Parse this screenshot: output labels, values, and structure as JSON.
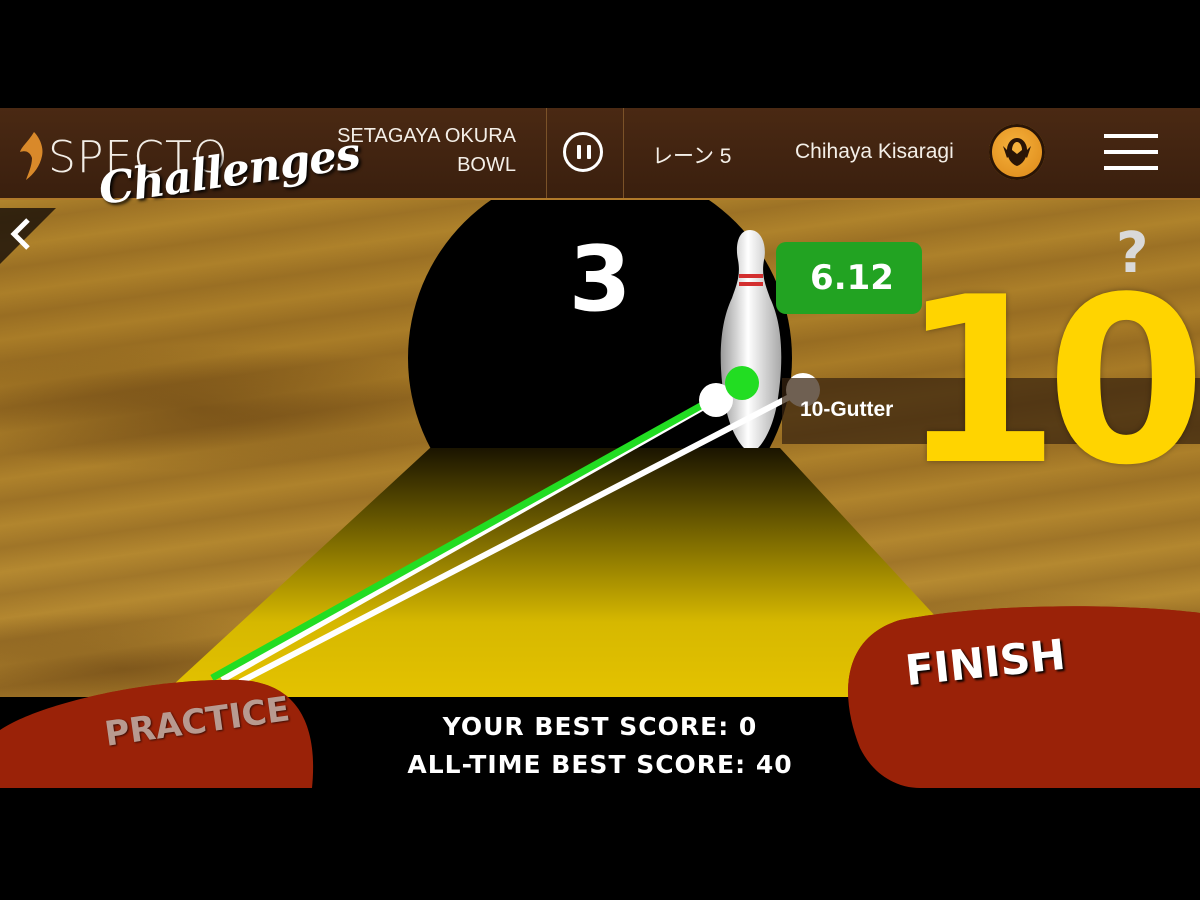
{
  "header": {
    "logo_main": "SPECTO",
    "logo_sub": "Challenges",
    "venue_line1": "SETAGAYA OKURA",
    "venue_line2": "BOWL",
    "lane": "レーン 5",
    "username": "Chihaya Kisaragi"
  },
  "game": {
    "countdown": "3",
    "score_badge": "6.12",
    "gutter_label": "10-Gutter",
    "big_number": "10",
    "help_mark": "?"
  },
  "footer": {
    "best_score": "YOUR BEST SCORE: 0",
    "all_time_best": "ALL-TIME BEST SCORE: 40",
    "practice_label": "PRACTICE",
    "finish_label": "FINISH"
  },
  "colors": {
    "accent_green": "#22a322",
    "number_yellow": "#ffd400",
    "button_red": "#9a2208",
    "header_brown": "#3a1f0e"
  },
  "icons": [
    "specto-bird-icon",
    "pause-icon",
    "avatar-bird-icon",
    "hamburger-menu-icon",
    "back-chevron-icon"
  ]
}
